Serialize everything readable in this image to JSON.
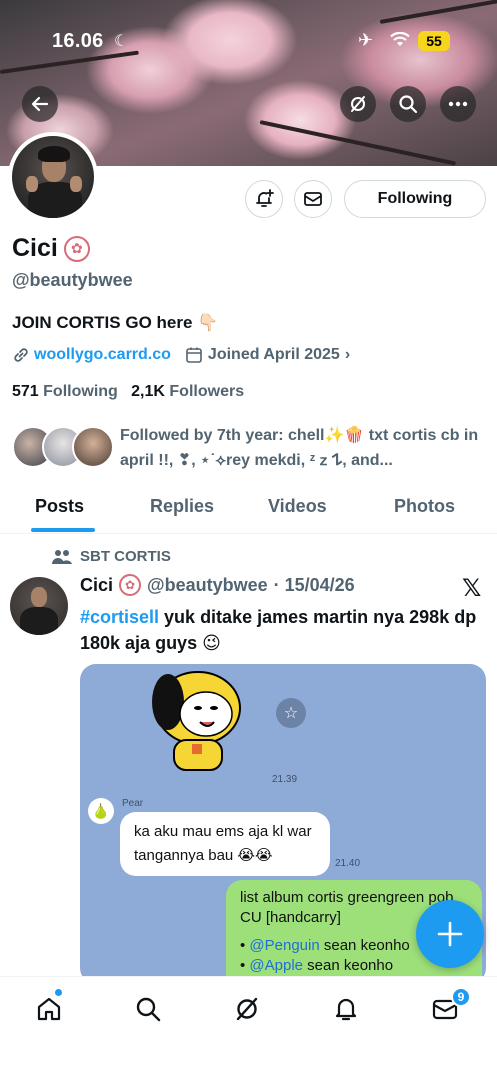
{
  "status_bar": {
    "time": "16.06",
    "battery": "55"
  },
  "profile": {
    "name": "Cici",
    "handle": "@beautybwee",
    "bio": "JOIN CORTIS GO here 👇🏻",
    "link": "woollygo.carrd.co",
    "joined": "Joined April 2025",
    "following_count": "571",
    "following_label": "Following",
    "followers_count": "2,1K",
    "followers_label": "Followers",
    "follow_button": "Following",
    "followed_by": "Followed by 7th year: chell✨🍿 txt cortis cb in april !!, ❣, ⋆˙⟡rey mekdi, ᶻ 𝗓 𐰁, and..."
  },
  "tabs": [
    "Posts",
    "Replies",
    "Videos",
    "Photos"
  ],
  "post": {
    "repost_label": "SBT CORTIS",
    "author_name": "Cici",
    "author_handle": "@beautybwee",
    "date": "· 15/04/26",
    "hashtag": "#cortisell",
    "text": " yuk ditake james martin nya 298k dp 180k aja guys 😉",
    "chat": {
      "time1": "21.39",
      "sender": "Pear",
      "incoming": "ka aku mau ems aja kl war tangannya bau 😭😭",
      "time2": "21.40",
      "outgoing_line1": "list album cortis greengreen pob CU [handcarry]",
      "mention1": "@Penguin",
      "mention1_rest": " sean keonho",
      "mention2": "@Apple",
      "mention2_rest": " sean keonho"
    }
  },
  "nav": {
    "messages_badge": "9"
  },
  "colors": {
    "accent": "#1d9bf0",
    "chat_bg": "#8eabd8",
    "outgoing_bubble": "#9de07a"
  }
}
